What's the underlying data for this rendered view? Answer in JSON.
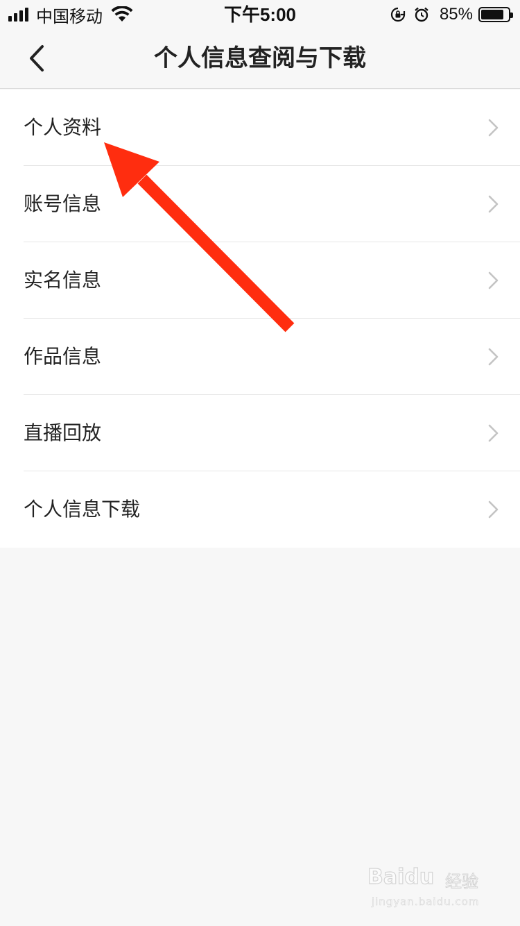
{
  "status_bar": {
    "carrier": "中国移动",
    "time": "下午5:00",
    "battery_percent": "85%",
    "battery_level": 0.85,
    "icons": [
      "signal-icon",
      "wifi-icon",
      "orientation-lock-icon",
      "alarm-icon",
      "battery-icon"
    ]
  },
  "nav": {
    "title": "个人信息查阅与下载",
    "back_icon": "chevron-left-icon"
  },
  "menu": {
    "items": [
      {
        "label": "个人资料"
      },
      {
        "label": "账号信息"
      },
      {
        "label": "实名信息"
      },
      {
        "label": "作品信息"
      },
      {
        "label": "直播回放"
      },
      {
        "label": "个人信息下载"
      }
    ],
    "chevron_icon": "chevron-right-icon"
  },
  "annotation": {
    "arrow_color": "#ff2d0f",
    "arrow_icon": "annotation-arrow-icon"
  },
  "watermark": {
    "brand": "Baidu",
    "cn": "经验",
    "url": "jingyan.baidu.com"
  },
  "colors": {
    "background": "#f7f7f7",
    "list_background": "#ffffff",
    "text": "#222222",
    "divider": "#e6e6e6",
    "chevron": "#c4c4c4"
  }
}
